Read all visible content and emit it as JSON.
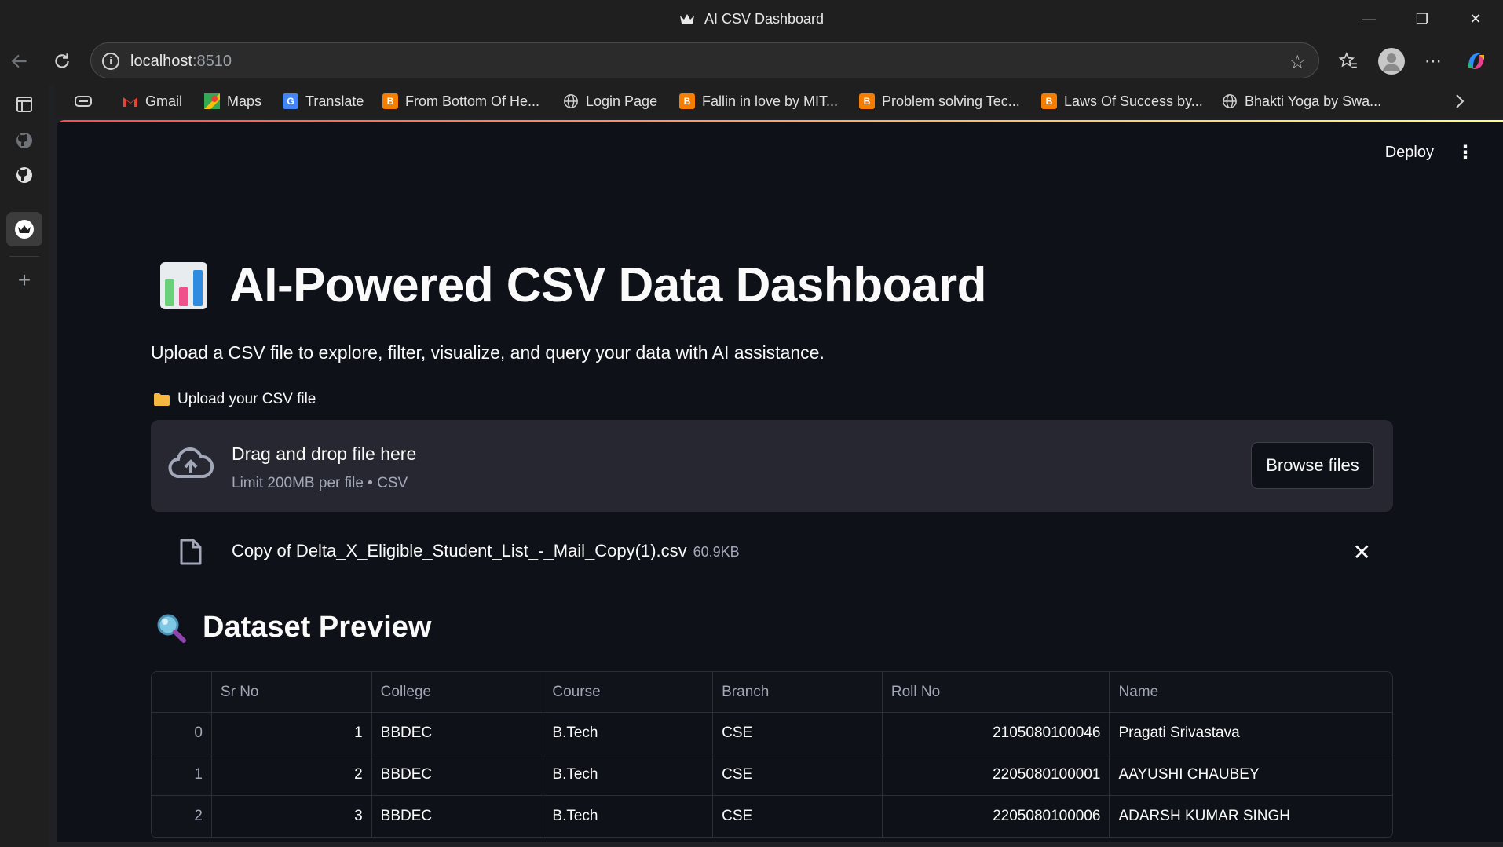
{
  "window": {
    "title": "AI CSV Dashboard",
    "controls": {
      "minimize": "—",
      "restore": "❐",
      "close": "✕"
    }
  },
  "browser": {
    "url_host": "localhost",
    "url_port": ":8510",
    "bookmarks": [
      {
        "label": "Gmail",
        "icon": "gmail-icon"
      },
      {
        "label": "Maps",
        "icon": "maps-icon"
      },
      {
        "label": "Translate",
        "icon": "translate-icon"
      },
      {
        "label": "From Bottom Of He...",
        "icon": "blogger-icon"
      },
      {
        "label": "Login Page",
        "icon": "globe-icon"
      },
      {
        "label": "Fallin in love by MIT...",
        "icon": "blogger-icon"
      },
      {
        "label": "Problem solving Tec...",
        "icon": "blogger-icon"
      },
      {
        "label": "Laws Of Success by...",
        "icon": "blogger-icon"
      },
      {
        "label": "Bhakti Yoga by Swa...",
        "icon": "globe-icon"
      }
    ]
  },
  "app": {
    "deploy_label": "Deploy",
    "title": "AI-Powered CSV Data Dashboard",
    "subtitle": "Upload a CSV file to explore, filter, visualize, and query your data with AI assistance.",
    "upload": {
      "label": "Upload your CSV file",
      "drop_title": "Drag and drop file here",
      "drop_limit": "Limit 200MB per file • CSV",
      "browse_label": "Browse files"
    },
    "file": {
      "name": "Copy of Delta_X_Eligible_Student_List_-_Mail_Copy(1).csv",
      "size": "60.9KB"
    },
    "preview": {
      "heading": "Dataset Preview",
      "columns": [
        "",
        "Sr No",
        "College",
        "Course",
        "Branch",
        "Roll No",
        "Name"
      ],
      "rows": [
        [
          "0",
          "1",
          "BBDEC",
          "B.Tech",
          "CSE",
          "2105080100046",
          "Pragati Srivastava"
        ],
        [
          "1",
          "2",
          "BBDEC",
          "B.Tech",
          "CSE",
          "2205080100001",
          "AAYUSHI CHAUBEY"
        ],
        [
          "2",
          "3",
          "BBDEC",
          "B.Tech",
          "CSE",
          "2205080100006",
          "ADARSH KUMAR SINGH"
        ]
      ]
    }
  }
}
